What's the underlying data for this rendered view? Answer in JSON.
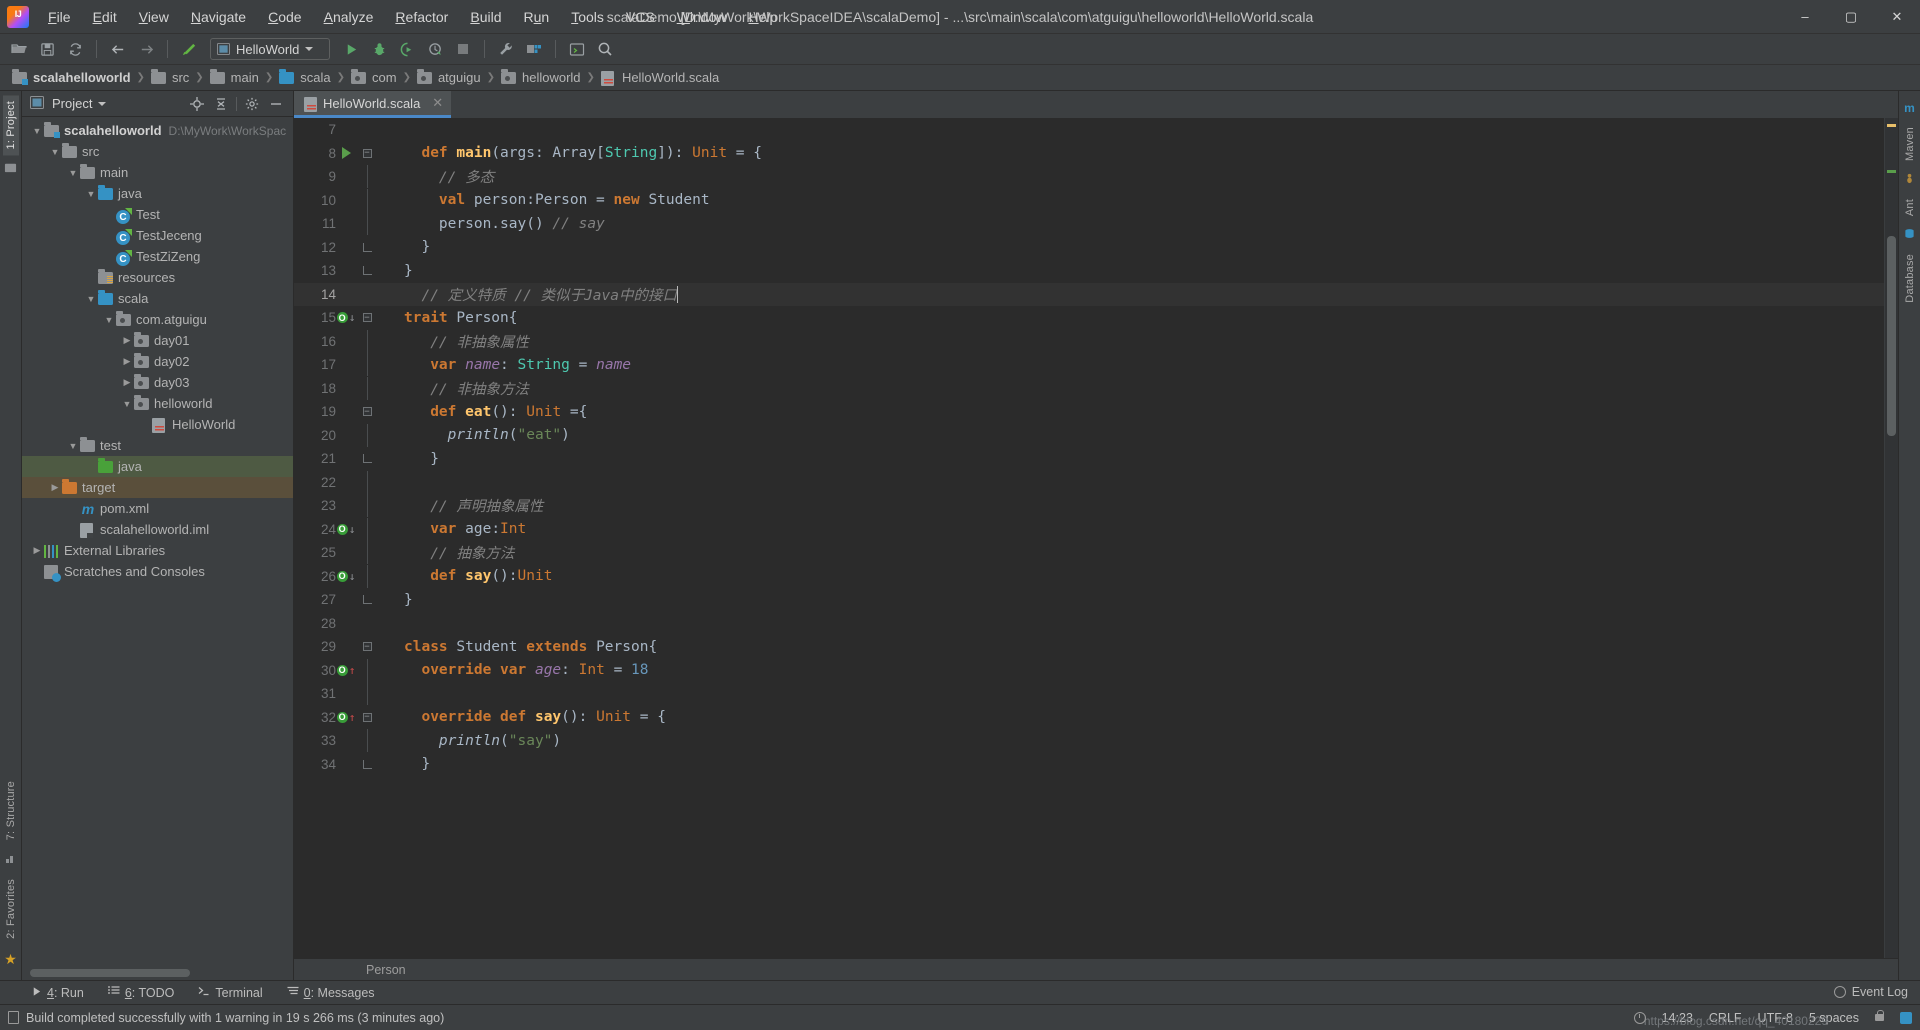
{
  "window": {
    "title": "scalaDemo [D:\\MyWork\\WorkSpaceIDEA\\scalaDemo] - ...\\src\\main\\scala\\com\\atguigu\\helloworld\\HelloWorld.scala",
    "minimize": "–",
    "maximize": "▢",
    "close": "✕"
  },
  "menu": [
    {
      "label": "File",
      "accel": "F"
    },
    {
      "label": "Edit",
      "accel": "E"
    },
    {
      "label": "View",
      "accel": "V"
    },
    {
      "label": "Navigate",
      "accel": "N"
    },
    {
      "label": "Code",
      "accel": "C"
    },
    {
      "label": "Analyze",
      "accel": "A"
    },
    {
      "label": "Refactor",
      "accel": "R"
    },
    {
      "label": "Build",
      "accel": "B"
    },
    {
      "label": "Run",
      "accel": "u"
    },
    {
      "label": "Tools",
      "accel": "T"
    },
    {
      "label": "VCS",
      "accel": ""
    },
    {
      "label": "Window",
      "accel": "W"
    },
    {
      "label": "Help",
      "accel": "H"
    }
  ],
  "toolbar": {
    "open_icon": "open-folder-icon",
    "save_icon": "save-icon",
    "sync_icon": "sync-icon",
    "back_icon": "back-arrow-icon",
    "forward_icon": "forward-arrow-icon",
    "build_icon": "build-hammer-icon",
    "run_config": "HelloWorld",
    "run_icon": "run-icon",
    "debug_icon": "debug-icon",
    "run_coverage_icon": "run-with-coverage-icon",
    "profile_icon": "profiler-icon",
    "stop_icon": "stop-icon",
    "settings_icon": "settings-wrench-icon",
    "project_structure_icon": "project-structure-icon",
    "terminal_icon": "terminal-icon",
    "search_icon": "search-everywhere-icon"
  },
  "breadcrumb": [
    {
      "label": "scalahelloworld",
      "icon": "module-folder-icon"
    },
    {
      "label": "src",
      "icon": "folder-icon"
    },
    {
      "label": "main",
      "icon": "folder-icon"
    },
    {
      "label": "scala",
      "icon": "source-folder-icon"
    },
    {
      "label": "com",
      "icon": "package-icon"
    },
    {
      "label": "atguigu",
      "icon": "package-icon"
    },
    {
      "label": "helloworld",
      "icon": "package-icon"
    },
    {
      "label": "HelloWorld.scala",
      "icon": "scala-file-icon"
    }
  ],
  "left_strip": {
    "project_tab": "1: Project",
    "structure_tab": "7: Structure",
    "favorites_tab": "2: Favorites"
  },
  "right_strip": {
    "maven_tab": "Maven",
    "ant_tab": "Ant",
    "database_tab": "Database"
  },
  "project_panel": {
    "title": "Project",
    "locate_icon": "locate-icon",
    "collapse_icon": "collapse-all-icon",
    "settings_icon": "gear-icon",
    "hide_icon": "hide-icon"
  },
  "tree": [
    {
      "label": "scalahelloworld",
      "path": "D:\\MyWork\\WorkSpac",
      "indent": 0,
      "twist": "▼",
      "icon": "module-folder-icon",
      "bold": true,
      "state": "none"
    },
    {
      "label": "src",
      "path": "",
      "indent": 1,
      "twist": "▼",
      "icon": "folder-gray-icon",
      "bold": false,
      "state": "none"
    },
    {
      "label": "main",
      "path": "",
      "indent": 2,
      "twist": "▼",
      "icon": "folder-gray-icon",
      "bold": false,
      "state": "none"
    },
    {
      "label": "java",
      "path": "",
      "indent": 3,
      "twist": "▼",
      "icon": "folder-blue-icon",
      "bold": false,
      "state": "none"
    },
    {
      "label": "Test",
      "path": "",
      "indent": 4,
      "twist": "",
      "icon": "scala-class-icon",
      "bold": false,
      "state": "none"
    },
    {
      "label": "TestJeceng",
      "path": "",
      "indent": 4,
      "twist": "",
      "icon": "scala-class-icon",
      "bold": false,
      "state": "none"
    },
    {
      "label": "TestZiZeng",
      "path": "",
      "indent": 4,
      "twist": "",
      "icon": "scala-class-icon",
      "bold": false,
      "state": "none"
    },
    {
      "label": "resources",
      "path": "",
      "indent": 3,
      "twist": "",
      "icon": "resources-folder-icon",
      "bold": false,
      "state": "none"
    },
    {
      "label": "scala",
      "path": "",
      "indent": 3,
      "twist": "▼",
      "icon": "folder-blue-icon",
      "bold": false,
      "state": "none"
    },
    {
      "label": "com.atguigu",
      "path": "",
      "indent": 4,
      "twist": "▼",
      "icon": "package-icon",
      "bold": false,
      "state": "none"
    },
    {
      "label": "day01",
      "path": "",
      "indent": 5,
      "twist": "▶",
      "icon": "package-icon",
      "bold": false,
      "state": "none"
    },
    {
      "label": "day02",
      "path": "",
      "indent": 5,
      "twist": "▶",
      "icon": "package-icon",
      "bold": false,
      "state": "none"
    },
    {
      "label": "day03",
      "path": "",
      "indent": 5,
      "twist": "▶",
      "icon": "package-icon",
      "bold": false,
      "state": "none"
    },
    {
      "label": "helloworld",
      "path": "",
      "indent": 5,
      "twist": "▼",
      "icon": "package-icon",
      "bold": false,
      "state": "none"
    },
    {
      "label": "HelloWorld",
      "path": "",
      "indent": 6,
      "twist": "",
      "icon": "scala-file-icon",
      "bold": false,
      "state": "none"
    },
    {
      "label": "test",
      "path": "",
      "indent": 2,
      "twist": "▼",
      "icon": "folder-gray-icon",
      "bold": false,
      "state": "none"
    },
    {
      "label": "java",
      "path": "",
      "indent": 3,
      "twist": "",
      "icon": "folder-green-icon",
      "bold": false,
      "state": "green"
    },
    {
      "label": "target",
      "path": "",
      "indent": 1,
      "twist": "▶",
      "icon": "folder-orange-icon",
      "bold": false,
      "state": "brown"
    },
    {
      "label": "pom.xml",
      "path": "",
      "indent": 2,
      "twist": "",
      "icon": "maven-icon",
      "bold": false,
      "state": "none"
    },
    {
      "label": "scalahelloworld.iml",
      "path": "",
      "indent": 2,
      "twist": "",
      "icon": "iml-icon",
      "bold": false,
      "state": "none"
    },
    {
      "label": "External Libraries",
      "path": "",
      "indent": 0,
      "twist": "▶",
      "icon": "libraries-icon",
      "bold": false,
      "state": "none"
    },
    {
      "label": "Scratches and Consoles",
      "path": "",
      "indent": 0,
      "twist": "",
      "icon": "scratches-icon",
      "bold": false,
      "state": "none"
    }
  ],
  "editor": {
    "tab": {
      "label": "HelloWorld.scala",
      "icon": "scala-file-icon",
      "close": "✕"
    },
    "breadcrumb": "Person",
    "lines": [
      {
        "n": "7",
        "gutter": "",
        "fold": "",
        "segs": []
      },
      {
        "n": "8",
        "gutter": "run",
        "fold": "start",
        "segs": [
          {
            "t": "  ",
            "c": "pun"
          },
          {
            "t": "def ",
            "c": "kw"
          },
          {
            "t": "main",
            "c": "fn2"
          },
          {
            "t": "(args: ",
            "c": "pun"
          },
          {
            "t": "Array",
            "c": "pun"
          },
          {
            "t": "[",
            "c": "pun"
          },
          {
            "t": "String",
            "c": "ty"
          },
          {
            "t": "]): ",
            "c": "pun"
          },
          {
            "t": "Unit",
            "c": "kw2"
          },
          {
            "t": " = {",
            "c": "pun"
          }
        ]
      },
      {
        "n": "9",
        "gutter": "",
        "fold": "bar",
        "segs": [
          {
            "t": "    // 多态",
            "c": "cm"
          }
        ]
      },
      {
        "n": "10",
        "gutter": "",
        "fold": "bar",
        "segs": [
          {
            "t": "    ",
            "c": "pun"
          },
          {
            "t": "val ",
            "c": "kw"
          },
          {
            "t": "person:Person = ",
            "c": "pun"
          },
          {
            "t": "new ",
            "c": "kw"
          },
          {
            "t": "Student",
            "c": "pun"
          }
        ]
      },
      {
        "n": "11",
        "gutter": "",
        "fold": "bar",
        "segs": [
          {
            "t": "    person.say() ",
            "c": "pun"
          },
          {
            "t": "// say",
            "c": "cm"
          }
        ]
      },
      {
        "n": "12",
        "gutter": "",
        "fold": "end",
        "segs": [
          {
            "t": "  }",
            "c": "pun"
          }
        ]
      },
      {
        "n": "13",
        "gutter": "",
        "fold": "end",
        "segs": [
          {
            "t": "}",
            "c": "pun"
          }
        ]
      },
      {
        "n": "14",
        "gutter": "",
        "fold": "",
        "current": true,
        "segs": [
          {
            "t": "  // 定义特质 // 类似于Java中的接口",
            "c": "cm"
          }
        ],
        "caret": true
      },
      {
        "n": "15",
        "gutter": "impl-down",
        "fold": "start",
        "segs": [
          {
            "t": "trait ",
            "c": "kw"
          },
          {
            "t": "Person",
            "c": "pun"
          },
          {
            "t": "{",
            "c": "pun"
          }
        ]
      },
      {
        "n": "16",
        "gutter": "",
        "fold": "bar",
        "segs": [
          {
            "t": "   // 非抽象属性",
            "c": "cm"
          }
        ]
      },
      {
        "n": "17",
        "gutter": "",
        "fold": "bar",
        "segs": [
          {
            "t": "   ",
            "c": "pun"
          },
          {
            "t": "var ",
            "c": "kw"
          },
          {
            "t": "name",
            "c": "fld"
          },
          {
            "t": ": ",
            "c": "pun"
          },
          {
            "t": "String",
            "c": "ty"
          },
          {
            "t": " = ",
            "c": "pun"
          },
          {
            "t": "name",
            "c": "fld"
          }
        ]
      },
      {
        "n": "18",
        "gutter": "",
        "fold": "bar",
        "segs": [
          {
            "t": "   // 非抽象方法",
            "c": "cm"
          }
        ]
      },
      {
        "n": "19",
        "gutter": "",
        "fold": "start",
        "segs": [
          {
            "t": "   ",
            "c": "pun"
          },
          {
            "t": "def ",
            "c": "kw"
          },
          {
            "t": "eat",
            "c": "fn2"
          },
          {
            "t": "(): ",
            "c": "pun"
          },
          {
            "t": "Unit",
            "c": "kw2"
          },
          {
            "t": " ={",
            "c": "pun"
          }
        ]
      },
      {
        "n": "20",
        "gutter": "",
        "fold": "bar",
        "segs": [
          {
            "t": "     ",
            "c": "pun"
          },
          {
            "t": "println",
            "c": "mth"
          },
          {
            "t": "(",
            "c": "pun"
          },
          {
            "t": "\"eat\"",
            "c": "st"
          },
          {
            "t": ")",
            "c": "pun"
          }
        ]
      },
      {
        "n": "21",
        "gutter": "",
        "fold": "end",
        "segs": [
          {
            "t": "   }",
            "c": "pun"
          }
        ]
      },
      {
        "n": "22",
        "gutter": "",
        "fold": "bar",
        "segs": []
      },
      {
        "n": "23",
        "gutter": "",
        "fold": "bar",
        "segs": [
          {
            "t": "   // 声明抽象属性",
            "c": "cm"
          }
        ]
      },
      {
        "n": "24",
        "gutter": "impl-down",
        "fold": "bar",
        "segs": [
          {
            "t": "   ",
            "c": "pun"
          },
          {
            "t": "var ",
            "c": "kw"
          },
          {
            "t": "age:",
            "c": "pun"
          },
          {
            "t": "Int",
            "c": "kw2"
          }
        ]
      },
      {
        "n": "25",
        "gutter": "",
        "fold": "bar",
        "segs": [
          {
            "t": "   // 抽象方法",
            "c": "cm"
          }
        ]
      },
      {
        "n": "26",
        "gutter": "impl-down",
        "fold": "bar",
        "segs": [
          {
            "t": "   ",
            "c": "pun"
          },
          {
            "t": "def ",
            "c": "kw"
          },
          {
            "t": "say",
            "c": "fn2"
          },
          {
            "t": "():",
            "c": "pun"
          },
          {
            "t": "Unit",
            "c": "kw2"
          }
        ]
      },
      {
        "n": "27",
        "gutter": "",
        "fold": "end",
        "segs": [
          {
            "t": "}",
            "c": "pun"
          }
        ]
      },
      {
        "n": "28",
        "gutter": "",
        "fold": "",
        "segs": []
      },
      {
        "n": "29",
        "gutter": "",
        "fold": "start",
        "segs": [
          {
            "t": "class ",
            "c": "kw"
          },
          {
            "t": "Student ",
            "c": "pun"
          },
          {
            "t": "extends ",
            "c": "kw"
          },
          {
            "t": "Person",
            "c": "pun"
          },
          {
            "t": "{",
            "c": "pun"
          }
        ]
      },
      {
        "n": "30",
        "gutter": "impl-up",
        "fold": "bar",
        "segs": [
          {
            "t": "  ",
            "c": "pun"
          },
          {
            "t": "override var ",
            "c": "kw"
          },
          {
            "t": "age",
            "c": "fld"
          },
          {
            "t": ": ",
            "c": "pun"
          },
          {
            "t": "Int",
            "c": "kw2"
          },
          {
            "t": " = ",
            "c": "pun"
          },
          {
            "t": "18",
            "c": "num2"
          }
        ]
      },
      {
        "n": "31",
        "gutter": "",
        "fold": "bar",
        "segs": []
      },
      {
        "n": "32",
        "gutter": "impl-up",
        "fold": "start",
        "segs": [
          {
            "t": "  ",
            "c": "pun"
          },
          {
            "t": "override def ",
            "c": "kw"
          },
          {
            "t": "say",
            "c": "fn2"
          },
          {
            "t": "(): ",
            "c": "pun"
          },
          {
            "t": "Unit",
            "c": "kw2"
          },
          {
            "t": " = {",
            "c": "pun"
          }
        ]
      },
      {
        "n": "33",
        "gutter": "",
        "fold": "bar",
        "segs": [
          {
            "t": "    ",
            "c": "pun"
          },
          {
            "t": "println",
            "c": "mth"
          },
          {
            "t": "(",
            "c": "pun"
          },
          {
            "t": "\"say\"",
            "c": "st"
          },
          {
            "t": ")",
            "c": "pun"
          }
        ]
      },
      {
        "n": "34",
        "gutter": "",
        "fold": "end",
        "segs": [
          {
            "t": "  }",
            "c": "pun"
          }
        ]
      }
    ]
  },
  "tool_windows": [
    {
      "label": "4: Run",
      "accel": "4",
      "icon": "run-icon"
    },
    {
      "label": "6: TODO",
      "accel": "6",
      "icon": "todo-icon"
    },
    {
      "label": "Terminal",
      "accel": "",
      "icon": "terminal-icon"
    },
    {
      "label": "0: Messages",
      "accel": "0",
      "icon": "messages-icon"
    }
  ],
  "status": {
    "message": "Build completed successfully with 1 warning in 19 s 266 ms (3 minutes ago)",
    "message_icon": "build-icon",
    "time": "14:23",
    "line_sep": "CRLF",
    "encoding": "UTF-8",
    "indent": "5 spaces",
    "event_log": "Event Log",
    "watermark": "https://blog.csdn.net/qq_40180229",
    "lock_icon": "lock-icon",
    "db_icon": "database-icon"
  },
  "colors": {
    "accent": "#4a88c7",
    "run_green": "#5a9e4b",
    "selection_green": "#4e5a43",
    "selection_brown": "#5a4f3b",
    "editor_bg": "#2b2b2b",
    "panel_bg": "#3c3f41"
  }
}
